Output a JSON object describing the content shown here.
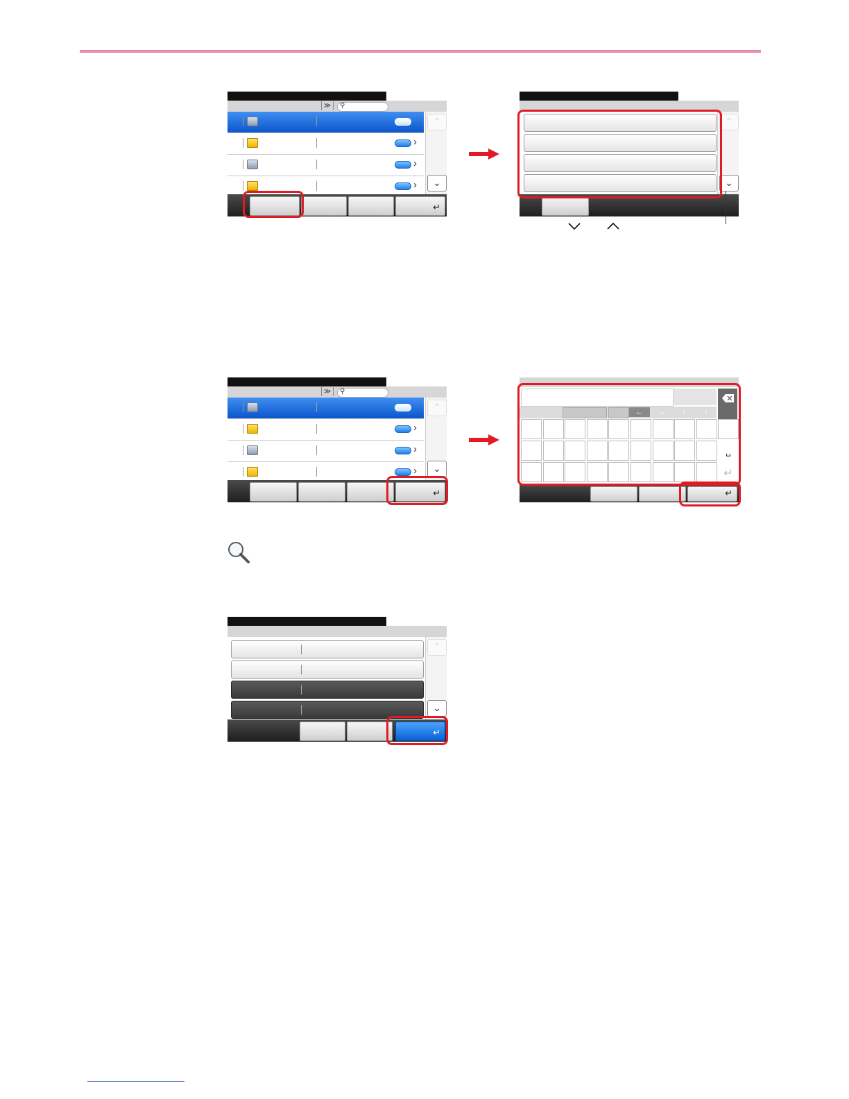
{
  "caption": {
    "down_icon": "chevron-down",
    "up_icon": "chevron-up"
  },
  "icons": {
    "tip": "magnifier-icon"
  }
}
